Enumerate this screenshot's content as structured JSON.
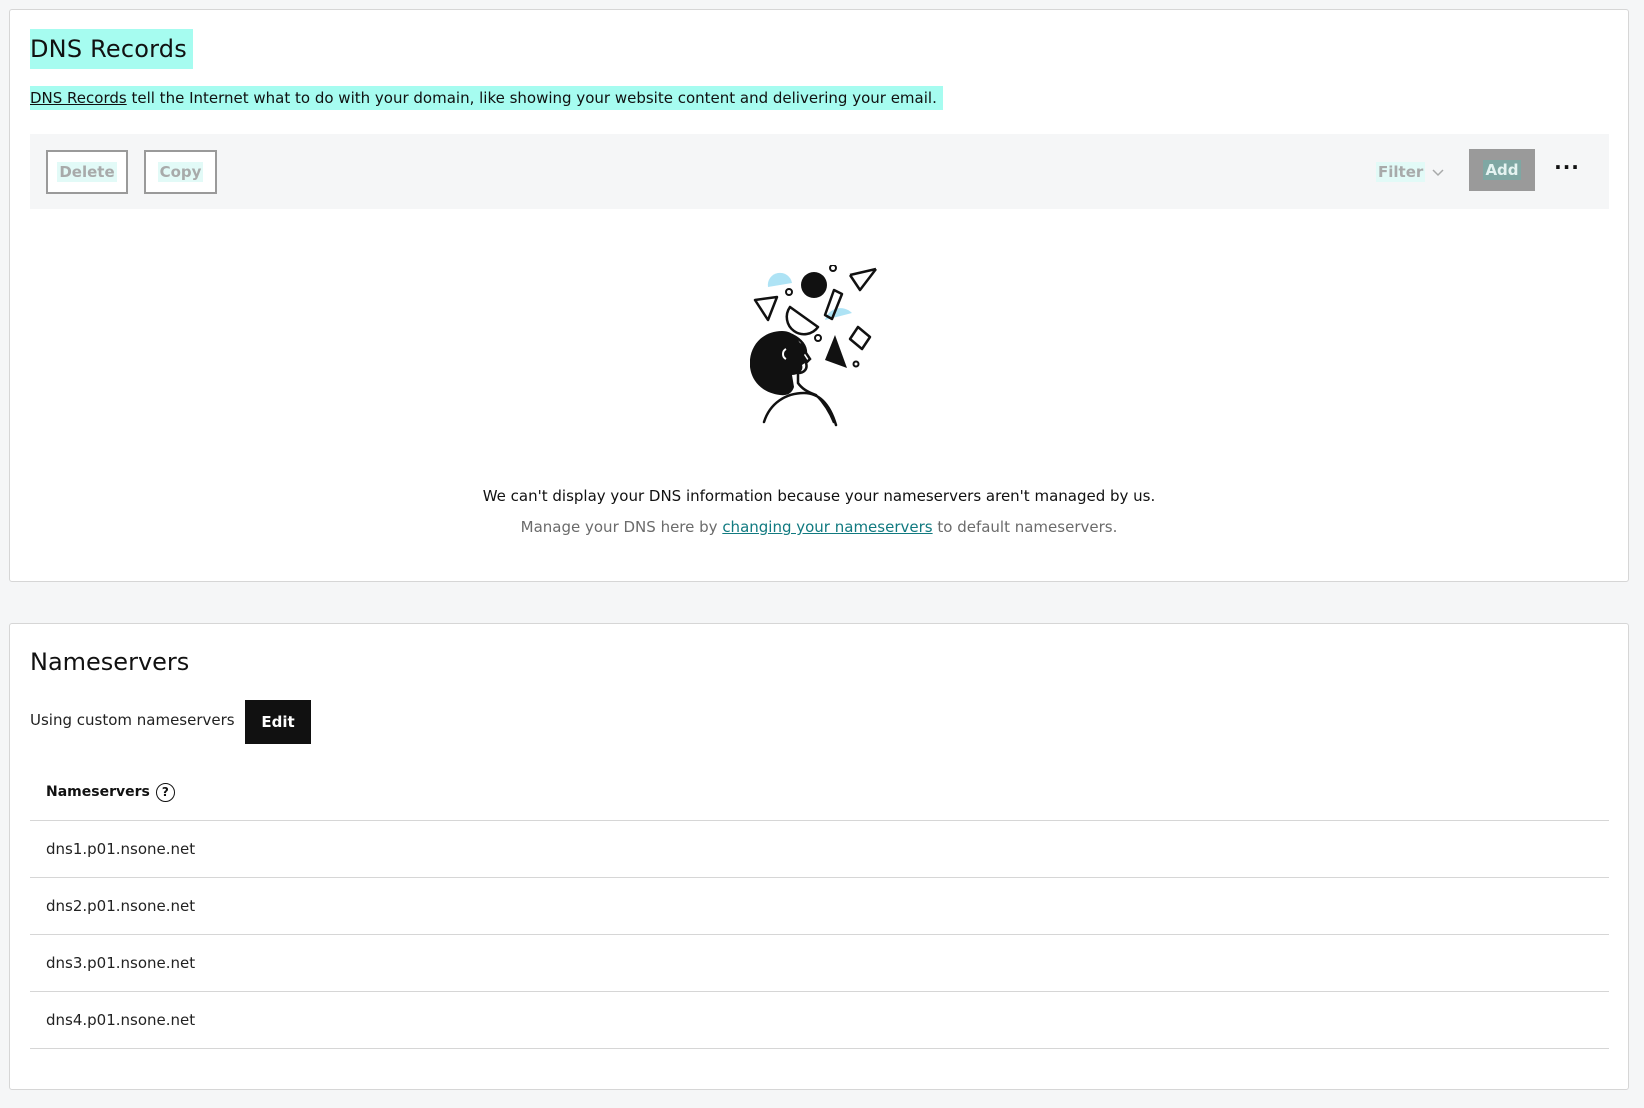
{
  "dns_records": {
    "title": "DNS Records",
    "description_link": "DNS Records",
    "description_text": " tell the Internet what to do with your domain, like showing your website content and delivering your email.",
    "toolbar": {
      "delete_label": "Delete",
      "copy_label": "Copy",
      "filter_label": "Filter",
      "add_label": "Add",
      "more_label": "···"
    },
    "empty_message": "We can't display your DNS information because your nameservers aren't managed by us.",
    "manage_prefix": "Manage your DNS here by ",
    "manage_link": "changing your nameservers",
    "manage_suffix": " to default nameservers."
  },
  "nameservers": {
    "title": "Nameservers",
    "status": "Using custom nameservers",
    "edit_label": "Edit",
    "column_header": "Nameservers",
    "help_glyph": "?",
    "rows": [
      "dns1.p01.nsone.net",
      "dns2.p01.nsone.net",
      "dns3.p01.nsone.net",
      "dns4.p01.nsone.net"
    ]
  },
  "colors": {
    "highlight": "#a6fcf0",
    "link_teal": "#117a80",
    "illustration_accent": "#aee3f5",
    "edit_button": "#111111"
  }
}
